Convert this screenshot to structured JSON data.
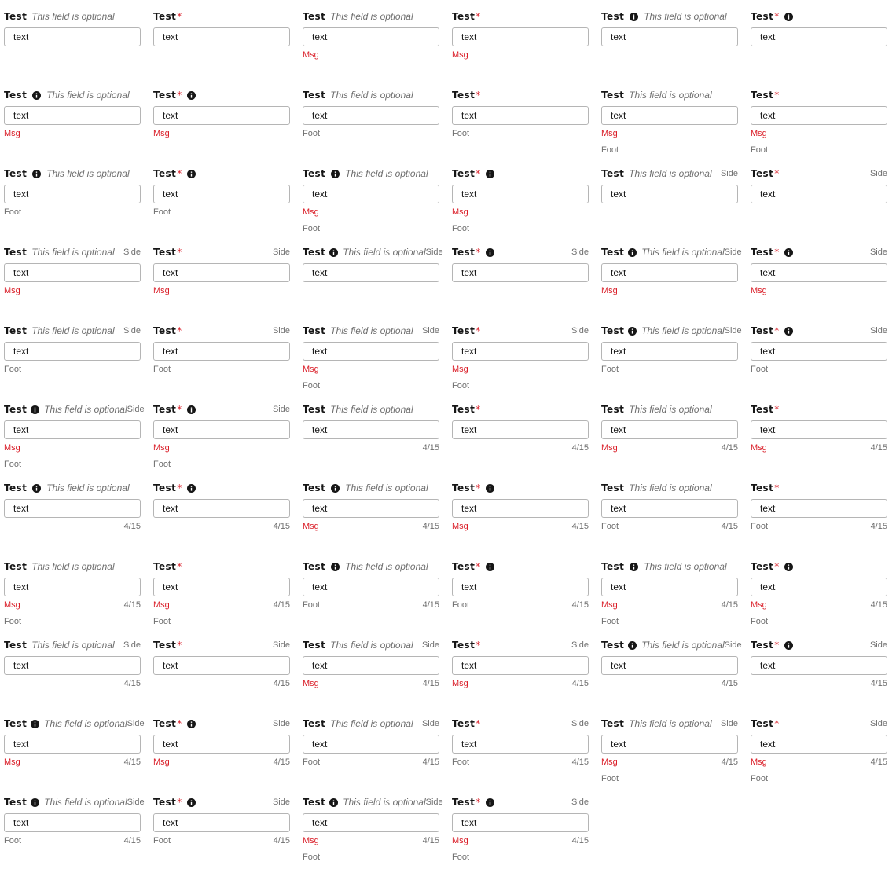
{
  "input_value": "text",
  "theme": {
    "required_color": "#da1e28",
    "muted_color": "#6f6f6f",
    "border_color": "#b5b5b5"
  },
  "fields": [
    {
      "label": "Test",
      "required": false,
      "info": false,
      "optional_text": "This field is optional",
      "side": "",
      "msg": "",
      "foot": "",
      "counter": ""
    },
    {
      "label": "Test",
      "required": true,
      "info": false,
      "optional_text": "",
      "side": "",
      "msg": "",
      "foot": "",
      "counter": ""
    },
    {
      "label": "Test",
      "required": false,
      "info": false,
      "optional_text": "This field is optional",
      "side": "",
      "msg": "Msg",
      "foot": "",
      "counter": ""
    },
    {
      "label": "Test",
      "required": true,
      "info": false,
      "optional_text": "",
      "side": "",
      "msg": "Msg",
      "foot": "",
      "counter": ""
    },
    {
      "label": "Test",
      "required": false,
      "info": true,
      "optional_text": "This field is optional",
      "side": "",
      "msg": "",
      "foot": "",
      "counter": ""
    },
    {
      "label": "Test",
      "required": true,
      "info": true,
      "optional_text": "",
      "side": "",
      "msg": "",
      "foot": "",
      "counter": ""
    },
    {
      "label": "Test",
      "required": false,
      "info": true,
      "optional_text": "This field is optional",
      "side": "",
      "msg": "Msg",
      "foot": "",
      "counter": ""
    },
    {
      "label": "Test",
      "required": true,
      "info": true,
      "optional_text": "",
      "side": "",
      "msg": "Msg",
      "foot": "",
      "counter": ""
    },
    {
      "label": "Test",
      "required": false,
      "info": false,
      "optional_text": "This field is optional",
      "side": "",
      "msg": "",
      "foot": "Foot",
      "counter": ""
    },
    {
      "label": "Test",
      "required": true,
      "info": false,
      "optional_text": "",
      "side": "",
      "msg": "",
      "foot": "Foot",
      "counter": ""
    },
    {
      "label": "Test",
      "required": false,
      "info": false,
      "optional_text": "This field is optional",
      "side": "",
      "msg": "Msg",
      "foot": "Foot",
      "counter": ""
    },
    {
      "label": "Test",
      "required": true,
      "info": false,
      "optional_text": "",
      "side": "",
      "msg": "Msg",
      "foot": "Foot",
      "counter": ""
    },
    {
      "label": "Test",
      "required": false,
      "info": true,
      "optional_text": "This field is optional",
      "side": "",
      "msg": "",
      "foot": "Foot",
      "counter": ""
    },
    {
      "label": "Test",
      "required": true,
      "info": true,
      "optional_text": "",
      "side": "",
      "msg": "",
      "foot": "Foot",
      "counter": ""
    },
    {
      "label": "Test",
      "required": false,
      "info": true,
      "optional_text": "This field is optional",
      "side": "",
      "msg": "Msg",
      "foot": "Foot",
      "counter": ""
    },
    {
      "label": "Test",
      "required": true,
      "info": true,
      "optional_text": "",
      "side": "",
      "msg": "Msg",
      "foot": "Foot",
      "counter": ""
    },
    {
      "label": "Test",
      "required": false,
      "info": false,
      "optional_text": "This field is optional",
      "side": "Side",
      "msg": "",
      "foot": "",
      "counter": ""
    },
    {
      "label": "Test",
      "required": true,
      "info": false,
      "optional_text": "",
      "side": "Side",
      "msg": "",
      "foot": "",
      "counter": ""
    },
    {
      "label": "Test",
      "required": false,
      "info": false,
      "optional_text": "This field is optional",
      "side": "Side",
      "msg": "Msg",
      "foot": "",
      "counter": ""
    },
    {
      "label": "Test",
      "required": true,
      "info": false,
      "optional_text": "",
      "side": "Side",
      "msg": "Msg",
      "foot": "",
      "counter": ""
    },
    {
      "label": "Test",
      "required": false,
      "info": true,
      "optional_text": "This field is optional",
      "side": "Side",
      "msg": "",
      "foot": "",
      "counter": ""
    },
    {
      "label": "Test",
      "required": true,
      "info": true,
      "optional_text": "",
      "side": "Side",
      "msg": "",
      "foot": "",
      "counter": ""
    },
    {
      "label": "Test",
      "required": false,
      "info": true,
      "optional_text": "This field is optional",
      "side": "Side",
      "msg": "Msg",
      "foot": "",
      "counter": ""
    },
    {
      "label": "Test",
      "required": true,
      "info": true,
      "optional_text": "",
      "side": "Side",
      "msg": "Msg",
      "foot": "",
      "counter": ""
    },
    {
      "label": "Test",
      "required": false,
      "info": false,
      "optional_text": "This field is optional",
      "side": "Side",
      "msg": "",
      "foot": "Foot",
      "counter": ""
    },
    {
      "label": "Test",
      "required": true,
      "info": false,
      "optional_text": "",
      "side": "Side",
      "msg": "",
      "foot": "Foot",
      "counter": ""
    },
    {
      "label": "Test",
      "required": false,
      "info": false,
      "optional_text": "This field is optional",
      "side": "Side",
      "msg": "Msg",
      "foot": "Foot",
      "counter": ""
    },
    {
      "label": "Test",
      "required": true,
      "info": false,
      "optional_text": "",
      "side": "Side",
      "msg": "Msg",
      "foot": "Foot",
      "counter": ""
    },
    {
      "label": "Test",
      "required": false,
      "info": true,
      "optional_text": "This field is optional",
      "side": "Side",
      "msg": "",
      "foot": "Foot",
      "counter": ""
    },
    {
      "label": "Test",
      "required": true,
      "info": true,
      "optional_text": "",
      "side": "Side",
      "msg": "",
      "foot": "Foot",
      "counter": ""
    },
    {
      "label": "Test",
      "required": false,
      "info": true,
      "optional_text": "This field is optional",
      "side": "Side",
      "msg": "Msg",
      "foot": "Foot",
      "counter": ""
    },
    {
      "label": "Test",
      "required": true,
      "info": true,
      "optional_text": "",
      "side": "Side",
      "msg": "Msg",
      "foot": "Foot",
      "counter": ""
    },
    {
      "label": "Test",
      "required": false,
      "info": false,
      "optional_text": "This field is optional",
      "side": "",
      "msg": "",
      "foot": "",
      "counter": "4/15"
    },
    {
      "label": "Test",
      "required": true,
      "info": false,
      "optional_text": "",
      "side": "",
      "msg": "",
      "foot": "",
      "counter": "4/15"
    },
    {
      "label": "Test",
      "required": false,
      "info": false,
      "optional_text": "This field is optional",
      "side": "",
      "msg": "Msg",
      "foot": "",
      "counter": "4/15"
    },
    {
      "label": "Test",
      "required": true,
      "info": false,
      "optional_text": "",
      "side": "",
      "msg": "Msg",
      "foot": "",
      "counter": "4/15"
    },
    {
      "label": "Test",
      "required": false,
      "info": true,
      "optional_text": "This field is optional",
      "side": "",
      "msg": "",
      "foot": "",
      "counter": "4/15"
    },
    {
      "label": "Test",
      "required": true,
      "info": true,
      "optional_text": "",
      "side": "",
      "msg": "",
      "foot": "",
      "counter": "4/15"
    },
    {
      "label": "Test",
      "required": false,
      "info": true,
      "optional_text": "This field is optional",
      "side": "",
      "msg": "Msg",
      "foot": "",
      "counter": "4/15"
    },
    {
      "label": "Test",
      "required": true,
      "info": true,
      "optional_text": "",
      "side": "",
      "msg": "Msg",
      "foot": "",
      "counter": "4/15"
    },
    {
      "label": "Test",
      "required": false,
      "info": false,
      "optional_text": "This field is optional",
      "side": "",
      "msg": "",
      "foot": "Foot",
      "counter": "4/15"
    },
    {
      "label": "Test",
      "required": true,
      "info": false,
      "optional_text": "",
      "side": "",
      "msg": "",
      "foot": "Foot",
      "counter": "4/15"
    },
    {
      "label": "Test",
      "required": false,
      "info": false,
      "optional_text": "This field is optional",
      "side": "",
      "msg": "Msg",
      "foot": "Foot",
      "counter": "4/15"
    },
    {
      "label": "Test",
      "required": true,
      "info": false,
      "optional_text": "",
      "side": "",
      "msg": "Msg",
      "foot": "Foot",
      "counter": "4/15"
    },
    {
      "label": "Test",
      "required": false,
      "info": true,
      "optional_text": "This field is optional",
      "side": "",
      "msg": "",
      "foot": "Foot",
      "counter": "4/15"
    },
    {
      "label": "Test",
      "required": true,
      "info": true,
      "optional_text": "",
      "side": "",
      "msg": "",
      "foot": "Foot",
      "counter": "4/15"
    },
    {
      "label": "Test",
      "required": false,
      "info": true,
      "optional_text": "This field is optional",
      "side": "",
      "msg": "Msg",
      "foot": "Foot",
      "counter": "4/15"
    },
    {
      "label": "Test",
      "required": true,
      "info": true,
      "optional_text": "",
      "side": "",
      "msg": "Msg",
      "foot": "Foot",
      "counter": "4/15"
    },
    {
      "label": "Test",
      "required": false,
      "info": false,
      "optional_text": "This field is optional",
      "side": "Side",
      "msg": "",
      "foot": "",
      "counter": "4/15"
    },
    {
      "label": "Test",
      "required": true,
      "info": false,
      "optional_text": "",
      "side": "Side",
      "msg": "",
      "foot": "",
      "counter": "4/15"
    },
    {
      "label": "Test",
      "required": false,
      "info": false,
      "optional_text": "This field is optional",
      "side": "Side",
      "msg": "Msg",
      "foot": "",
      "counter": "4/15"
    },
    {
      "label": "Test",
      "required": true,
      "info": false,
      "optional_text": "",
      "side": "Side",
      "msg": "Msg",
      "foot": "",
      "counter": "4/15"
    },
    {
      "label": "Test",
      "required": false,
      "info": true,
      "optional_text": "This field is optional",
      "side": "Side",
      "msg": "",
      "foot": "",
      "counter": "4/15"
    },
    {
      "label": "Test",
      "required": true,
      "info": true,
      "optional_text": "",
      "side": "Side",
      "msg": "",
      "foot": "",
      "counter": "4/15"
    },
    {
      "label": "Test",
      "required": false,
      "info": true,
      "optional_text": "This field is optional",
      "side": "Side",
      "msg": "Msg",
      "foot": "",
      "counter": "4/15"
    },
    {
      "label": "Test",
      "required": true,
      "info": true,
      "optional_text": "",
      "side": "Side",
      "msg": "Msg",
      "foot": "",
      "counter": "4/15"
    },
    {
      "label": "Test",
      "required": false,
      "info": false,
      "optional_text": "This field is optional",
      "side": "Side",
      "msg": "",
      "foot": "Foot",
      "counter": "4/15"
    },
    {
      "label": "Test",
      "required": true,
      "info": false,
      "optional_text": "",
      "side": "Side",
      "msg": "",
      "foot": "Foot",
      "counter": "4/15"
    },
    {
      "label": "Test",
      "required": false,
      "info": false,
      "optional_text": "This field is optional",
      "side": "Side",
      "msg": "Msg",
      "foot": "Foot",
      "counter": "4/15"
    },
    {
      "label": "Test",
      "required": true,
      "info": false,
      "optional_text": "",
      "side": "Side",
      "msg": "Msg",
      "foot": "Foot",
      "counter": "4/15"
    },
    {
      "label": "Test",
      "required": false,
      "info": true,
      "optional_text": "This field is optional",
      "side": "Side",
      "msg": "",
      "foot": "Foot",
      "counter": "4/15"
    },
    {
      "label": "Test",
      "required": true,
      "info": true,
      "optional_text": "",
      "side": "Side",
      "msg": "",
      "foot": "Foot",
      "counter": "4/15"
    },
    {
      "label": "Test",
      "required": false,
      "info": true,
      "optional_text": "This field is optional",
      "side": "Side",
      "msg": "Msg",
      "foot": "Foot",
      "counter": "4/15"
    },
    {
      "label": "Test",
      "required": true,
      "info": true,
      "optional_text": "",
      "side": "Side",
      "msg": "Msg",
      "foot": "Foot",
      "counter": "4/15"
    }
  ]
}
